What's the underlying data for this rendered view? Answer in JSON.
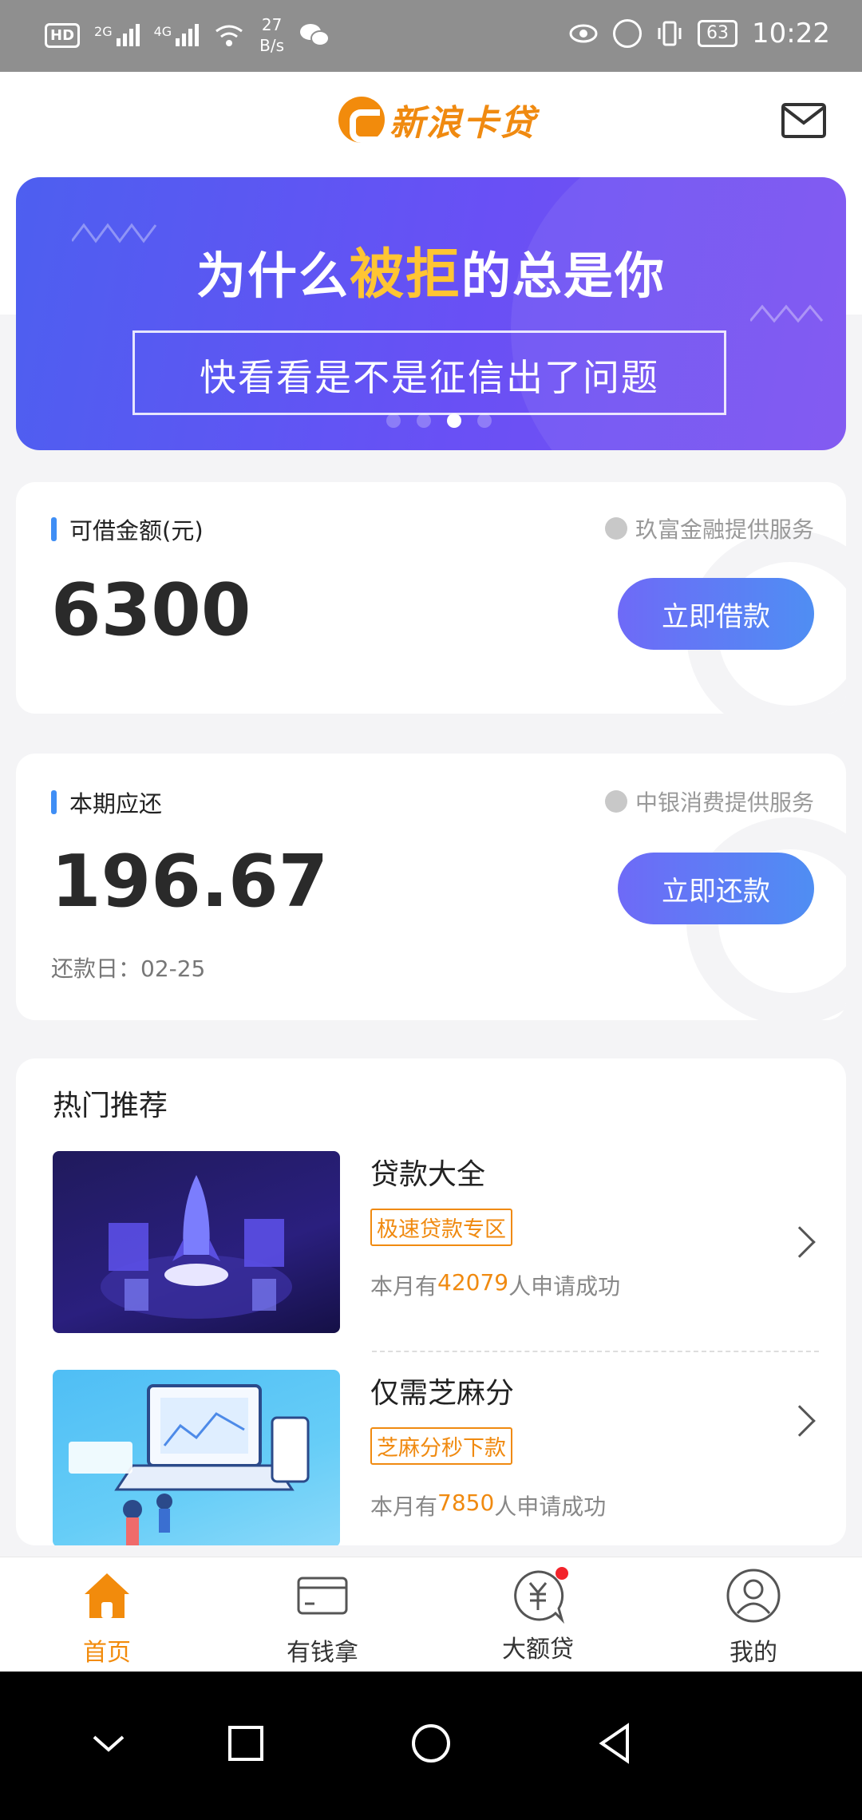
{
  "status_bar": {
    "hd": "HD",
    "net1": "2G",
    "net2": "4G",
    "speed_value": "27",
    "speed_unit": "B/s",
    "battery": "63",
    "time": "10:22"
  },
  "header": {
    "logo_text": "新浪卡贷"
  },
  "banner": {
    "title_before": "为什么",
    "title_highlight": "被拒",
    "title_after": "的总是你",
    "subtitle": "快看看是不是征信出了问题",
    "dots": 4,
    "active_dot": 2
  },
  "loan_card": {
    "label": "可借金额(元)",
    "provider": "玖富金融提供服务",
    "amount": "6300",
    "button": "立即借款"
  },
  "repay_card": {
    "label": "本期应还",
    "provider": "中银消费提供服务",
    "amount": "196.67",
    "due_date": "还款日：02-25",
    "button": "立即还款"
  },
  "hot": {
    "title": "热门推荐",
    "items": [
      {
        "title": "贷款大全",
        "tag": "极速贷款专区",
        "desc_prefix": "本月有",
        "count": "42079",
        "desc_suffix": "人申请成功"
      },
      {
        "title": "仅需芝麻分",
        "tag": "芝麻分秒下款",
        "desc_prefix": "本月有",
        "count": "7850",
        "desc_suffix": "人申请成功"
      }
    ]
  },
  "bottom_nav": {
    "items": [
      {
        "label": "首页",
        "active": true
      },
      {
        "label": "有钱拿",
        "active": false
      },
      {
        "label": "大额贷",
        "active": false,
        "badge": true
      },
      {
        "label": "我的",
        "active": false
      }
    ]
  },
  "colors": {
    "brand_orange": "#f28b0c",
    "button_gradient_start": "#6e6af7",
    "button_gradient_end": "#4f8ef3",
    "accent_blue": "#3f8ef5",
    "badge_red": "#f3232b"
  }
}
